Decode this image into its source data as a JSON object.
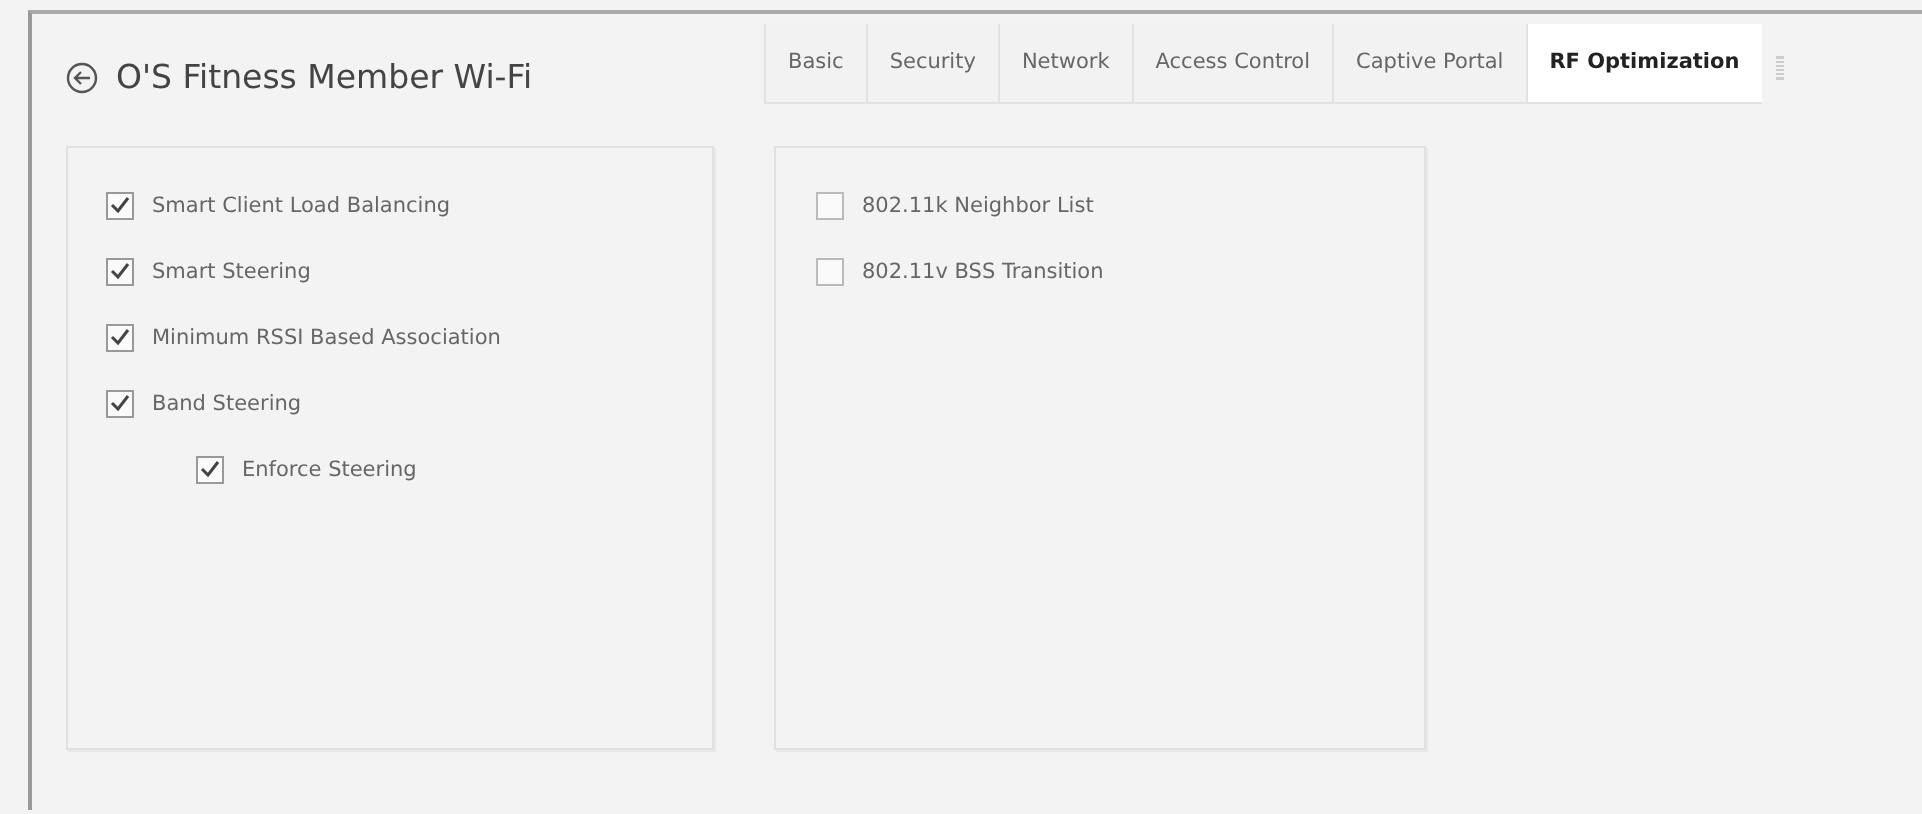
{
  "header": {
    "title": "O'S Fitness Member Wi-Fi"
  },
  "tabs": [
    {
      "label": "Basic",
      "selected": false
    },
    {
      "label": "Security",
      "selected": false
    },
    {
      "label": "Network",
      "selected": false
    },
    {
      "label": "Access Control",
      "selected": false
    },
    {
      "label": "Captive Portal",
      "selected": false
    },
    {
      "label": "RF Optimization",
      "selected": true
    }
  ],
  "panels": [
    {
      "options": [
        {
          "label": "Smart Client Load Balancing",
          "checked": true
        },
        {
          "label": "Smart Steering",
          "checked": true
        },
        {
          "label": "Minimum RSSI Based Association",
          "checked": true
        },
        {
          "label": "Band Steering",
          "checked": true,
          "children": [
            {
              "label": "Enforce Steering",
              "checked": true
            }
          ]
        }
      ]
    },
    {
      "options": [
        {
          "label": "802.11k Neighbor List",
          "checked": false
        },
        {
          "label": "802.11v BSS Transition",
          "checked": false
        }
      ]
    }
  ]
}
